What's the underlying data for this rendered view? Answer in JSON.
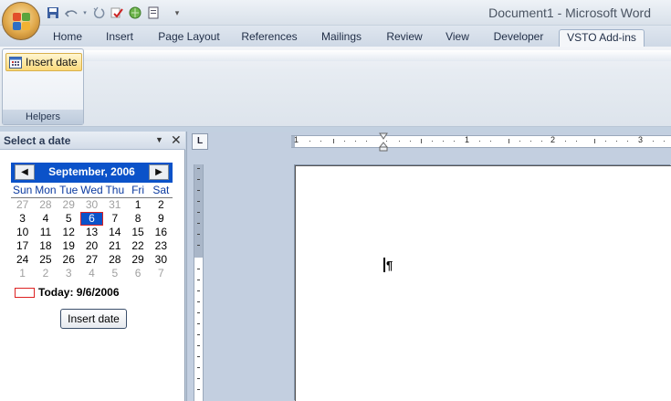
{
  "window": {
    "title": "Document1 - Microsoft Word"
  },
  "qat": {
    "icons": [
      "save-icon",
      "undo-icon",
      "redo-icon",
      "spelling-icon",
      "web-icon",
      "print-preview-icon",
      "customize-qat-icon"
    ]
  },
  "tabs": [
    "Home",
    "Insert",
    "Page Layout",
    "References",
    "Mailings",
    "Review",
    "View",
    "Developer",
    "VSTO Add-ins"
  ],
  "active_tab": "VSTO Add-ins",
  "ribbon": {
    "insert_date_label": "Insert date",
    "group_label": "Helpers"
  },
  "taskpane": {
    "title": "Select a date",
    "calendar": {
      "month_label": "September, 2006",
      "prev_glyph": "◀",
      "next_glyph": "▶",
      "weekdays": [
        "Sun",
        "Mon",
        "Tue",
        "Wed",
        "Thu",
        "Fri",
        "Sat"
      ],
      "weeks": [
        [
          "27",
          "28",
          "29",
          "30",
          "31",
          "1",
          "2"
        ],
        [
          "3",
          "4",
          "5",
          "6",
          "7",
          "8",
          "9"
        ],
        [
          "10",
          "11",
          "12",
          "13",
          "14",
          "15",
          "16"
        ],
        [
          "17",
          "18",
          "19",
          "20",
          "21",
          "22",
          "23"
        ],
        [
          "24",
          "25",
          "26",
          "27",
          "28",
          "29",
          "30"
        ],
        [
          "1",
          "2",
          "3",
          "4",
          "5",
          "6",
          "7"
        ]
      ],
      "selected_day": "6",
      "today_label": "Today: 9/6/2006"
    },
    "insert_button": "Insert date"
  },
  "ruler": {
    "labels": [
      "1",
      "1",
      "2",
      "3"
    ],
    "corner_glyph": "L"
  },
  "document": {
    "pilcrow": "¶"
  },
  "colors": {
    "calendar_header": "#0b52c9",
    "selection": "#0b52c9",
    "today_border": "#dd2222",
    "ribbon_button_hover": "#fbd97a"
  }
}
